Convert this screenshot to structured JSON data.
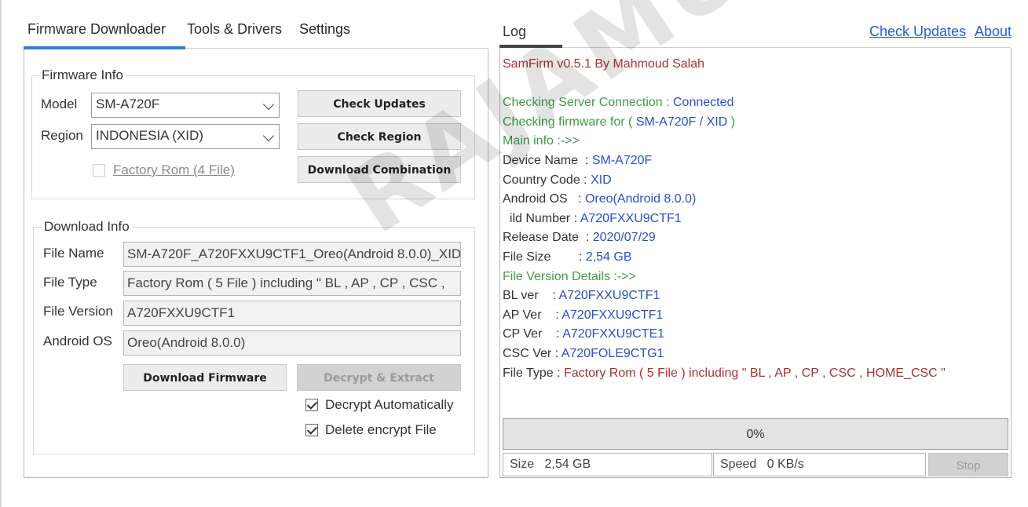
{
  "tabs": [
    {
      "label": "Firmware Downloader",
      "active": true
    },
    {
      "label": "Tools & Drivers",
      "active": false
    },
    {
      "label": "Settings",
      "active": false
    }
  ],
  "firmware_info": {
    "title": "Firmware Info",
    "model_label": "Model",
    "model_value": "SM-A720F",
    "region_label": "Region",
    "region_value": "INDONESIA (XID)",
    "factory_rom_label": "Factory Rom (4 File)",
    "factory_rom_checked": false,
    "check_updates_button": "Check Updates",
    "check_region_button": "Check Region",
    "download_combination_button": "Download Combination"
  },
  "download_info": {
    "title": "Download Info",
    "file_name_label": "File Name",
    "file_name_value": "SM-A720F_A720FXXU9CTF1_Oreo(Android 8.0.0)_XID",
    "file_type_label": "File Type",
    "file_type_value": "Factory Rom ( 5 File ) including \" BL , AP , CP , CSC ,",
    "file_version_label": "File Version",
    "file_version_value": "A720FXXU9CTF1",
    "android_os_label": "Android OS",
    "android_os_value": "Oreo(Android 8.0.0)",
    "download_firmware_button": "Download Firmware",
    "decrypt_extract_button": "Decrypt & Extract",
    "decrypt_auto_label": "Decrypt Automatically",
    "decrypt_auto_checked": true,
    "delete_encrypt_label": "Delete encrypt File",
    "delete_encrypt_checked": true
  },
  "log": {
    "tab_label": "Log",
    "check_updates_link": "Check Updates",
    "about_link": "About",
    "lines": [
      [
        {
          "text": "SamFirm v0.5.1 By Mahmoud Salah",
          "color": "#a83232"
        }
      ],
      [],
      [
        {
          "text": "Checking Server Connection : ",
          "color": "#3e9b46"
        },
        {
          "text": "Connected",
          "color": "#2a4fc9"
        }
      ],
      [
        {
          "text": "Checking firmware for ( ",
          "color": "#3e9b46"
        },
        {
          "text": "SM-A720F / XID",
          "color": "#2a4fc9"
        },
        {
          "text": " )",
          "color": "#3e9b46"
        }
      ],
      [
        {
          "text": "Main info :->>",
          "color": "#3e9b46"
        }
      ],
      [
        {
          "text": "Device Name  : ",
          "color": "#333333"
        },
        {
          "text": "SM-A720F",
          "color": "#2a4fc9"
        }
      ],
      [
        {
          "text": "Country Code : ",
          "color": "#333333"
        },
        {
          "text": "XID",
          "color": "#2a4fc9"
        }
      ],
      [
        {
          "text": "Android OS   : ",
          "color": "#333333"
        },
        {
          "text": "Oreo(Android 8.0.0)",
          "color": "#2a4fc9"
        }
      ],
      [
        {
          "text": "  ild Number : ",
          "color": "#333333"
        },
        {
          "text": "A720FXXU9CTF1",
          "color": "#2a4fc9"
        }
      ],
      [
        {
          "text": "Release Date  : ",
          "color": "#333333"
        },
        {
          "text": "2020/07/29",
          "color": "#2a4fc9"
        }
      ],
      [
        {
          "text": "File Size        : ",
          "color": "#333333"
        },
        {
          "text": "2,54 GB",
          "color": "#2a4fc9"
        }
      ],
      [
        {
          "text": "File Version Details :->>",
          "color": "#3e9b46"
        }
      ],
      [
        {
          "text": "BL ver    : ",
          "color": "#333333"
        },
        {
          "text": "A720FXXU9CTF1",
          "color": "#2a4fc9"
        }
      ],
      [
        {
          "text": "AP Ver    : ",
          "color": "#333333"
        },
        {
          "text": "A720FXXU9CTF1",
          "color": "#2a4fc9"
        }
      ],
      [
        {
          "text": "CP Ver    : ",
          "color": "#333333"
        },
        {
          "text": "A720FXXU9CTE1",
          "color": "#2a4fc9"
        }
      ],
      [
        {
          "text": "CSC Ver : ",
          "color": "#333333"
        },
        {
          "text": "A720FOLE9CTG1",
          "color": "#2a4fc9"
        }
      ],
      [
        {
          "text": "File Type : ",
          "color": "#333333"
        },
        {
          "text": "Factory Rom ( 5 File ) including \" BL , AP , CP , CSC , HOME_CSC \"",
          "color": "#a83232"
        }
      ]
    ]
  },
  "progress": {
    "label": "0%",
    "value": 0
  },
  "status": {
    "size_label": "Size",
    "size_value": "2,54 GB",
    "speed_label": "Speed",
    "speed_value": "0 KB/s",
    "stop_button": "Stop"
  },
  "watermark": "RAJAMUS"
}
